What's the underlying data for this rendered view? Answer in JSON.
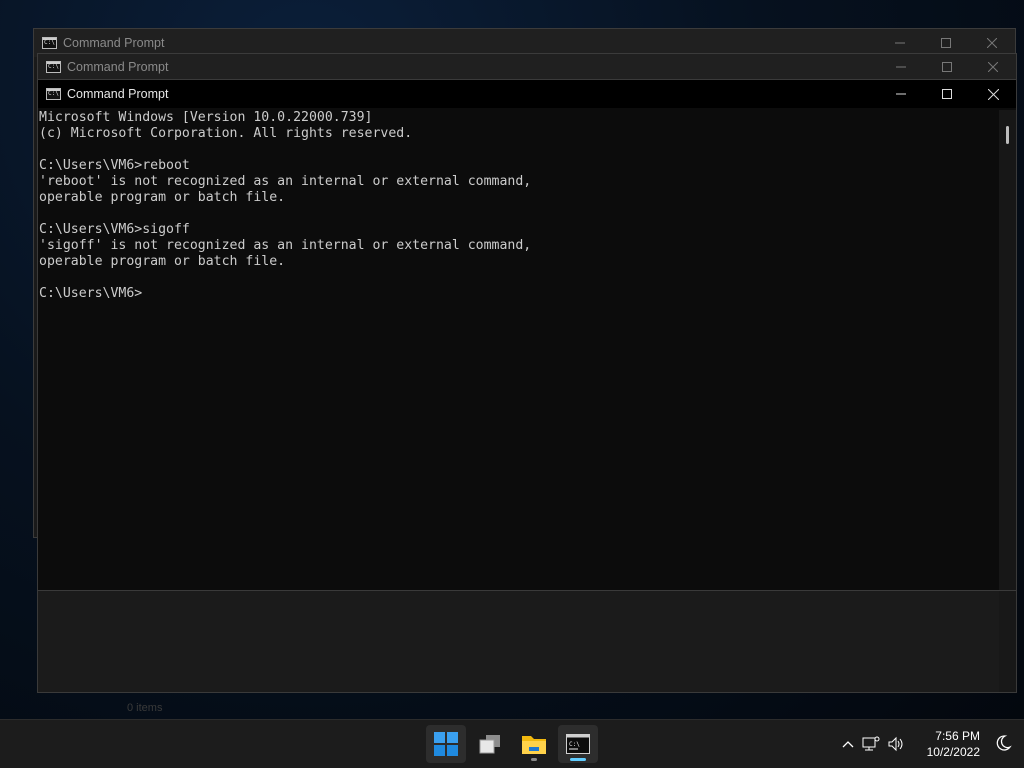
{
  "windows": {
    "back1_title": "Command Prompt",
    "back2_title": "Command Prompt",
    "main_title": "Command Prompt"
  },
  "console": {
    "lines": [
      "Microsoft Windows [Version 10.0.22000.739]",
      "(c) Microsoft Corporation. All rights reserved.",
      "",
      "C:\\Users\\VM6>reboot",
      "'reboot' is not recognized as an internal or external command,",
      "operable program or batch file.",
      "",
      "C:\\Users\\VM6>sigoff",
      "'sigoff' is not recognized as an internal or external command,",
      "operable program or batch file.",
      "",
      "C:\\Users\\VM6>"
    ]
  },
  "background_status": "0 items",
  "taskbar": {
    "apps": [
      {
        "name": "start-button",
        "icon": "windows-logo-icon"
      },
      {
        "name": "task-view-button",
        "icon": "task-view-icon"
      },
      {
        "name": "file-explorer-button",
        "icon": "folder-icon"
      },
      {
        "name": "command-prompt-taskbar-button",
        "icon": "cmd-icon"
      }
    ],
    "time": "7:56 PM",
    "date": "10/2/2022"
  },
  "colors": {
    "accent": "#60cdff",
    "console_text": "#cccccc",
    "console_bg": "#0c0c0c"
  }
}
